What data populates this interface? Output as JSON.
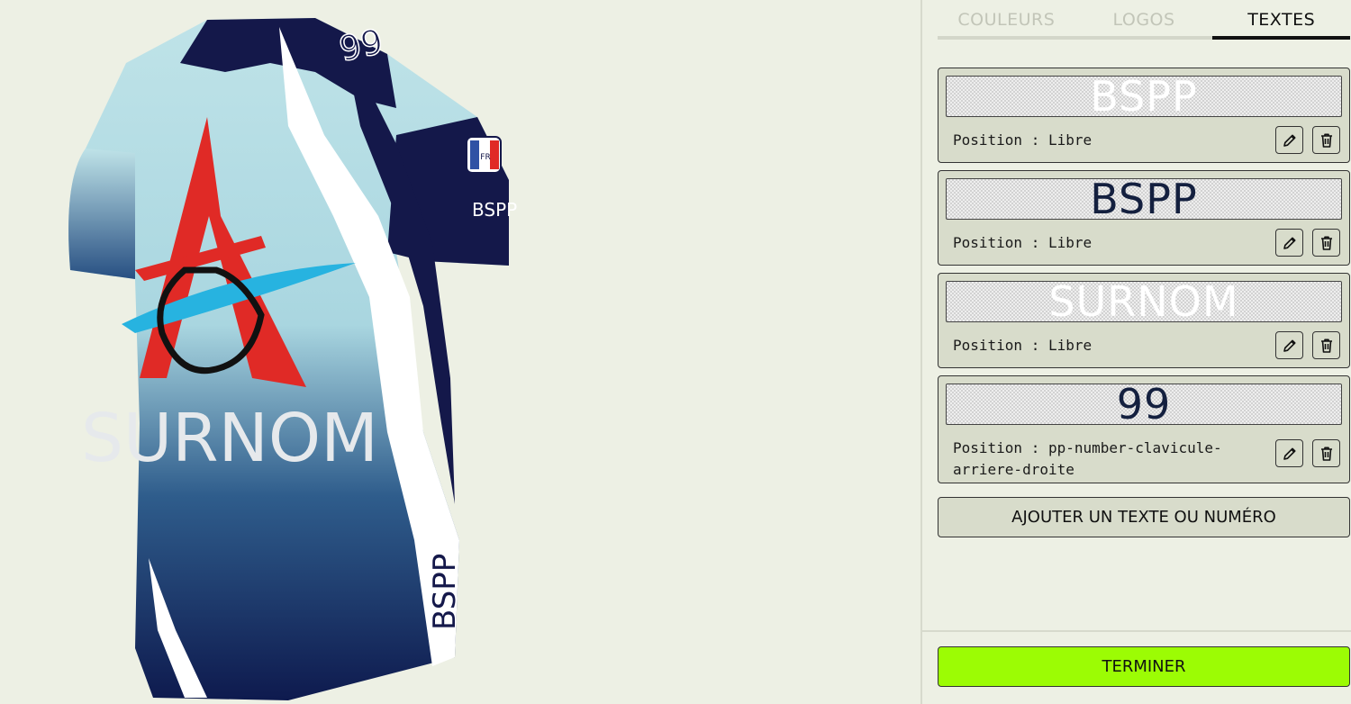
{
  "jersey": {
    "back_name": "SURNOM",
    "side_text": "BSPP",
    "number": "99",
    "sleeve_text": "BSPP",
    "flag_code": "FR",
    "colors": {
      "navy": "#14184a",
      "light_blue": "#b3dfe5",
      "white": "#ffffff",
      "red": "#e02a26",
      "cyan": "#27b3e0"
    }
  },
  "tabs": [
    {
      "label": "COULEURS",
      "active": false
    },
    {
      "label": "LOGOS",
      "active": false
    },
    {
      "label": "TEXTES",
      "active": true
    }
  ],
  "texts": [
    {
      "preview": "BSPP",
      "color": "#ffffff",
      "position_label": "Position : Libre"
    },
    {
      "preview": "BSPP",
      "color": "#14203f",
      "position_label": "Position : Libre"
    },
    {
      "preview": "SURNOM",
      "color": "#ffffff",
      "position_label": "Position : Libre"
    },
    {
      "preview": "99",
      "color": "#14203f",
      "position_label": "Position : pp-number-clavicule-arriere-droite"
    }
  ],
  "add_button": "AJOUTER UN TEXTE OU NUMÉRO",
  "finish_button": "TERMINER",
  "icons": {
    "edit": "pencil-icon",
    "delete": "trash-icon"
  }
}
